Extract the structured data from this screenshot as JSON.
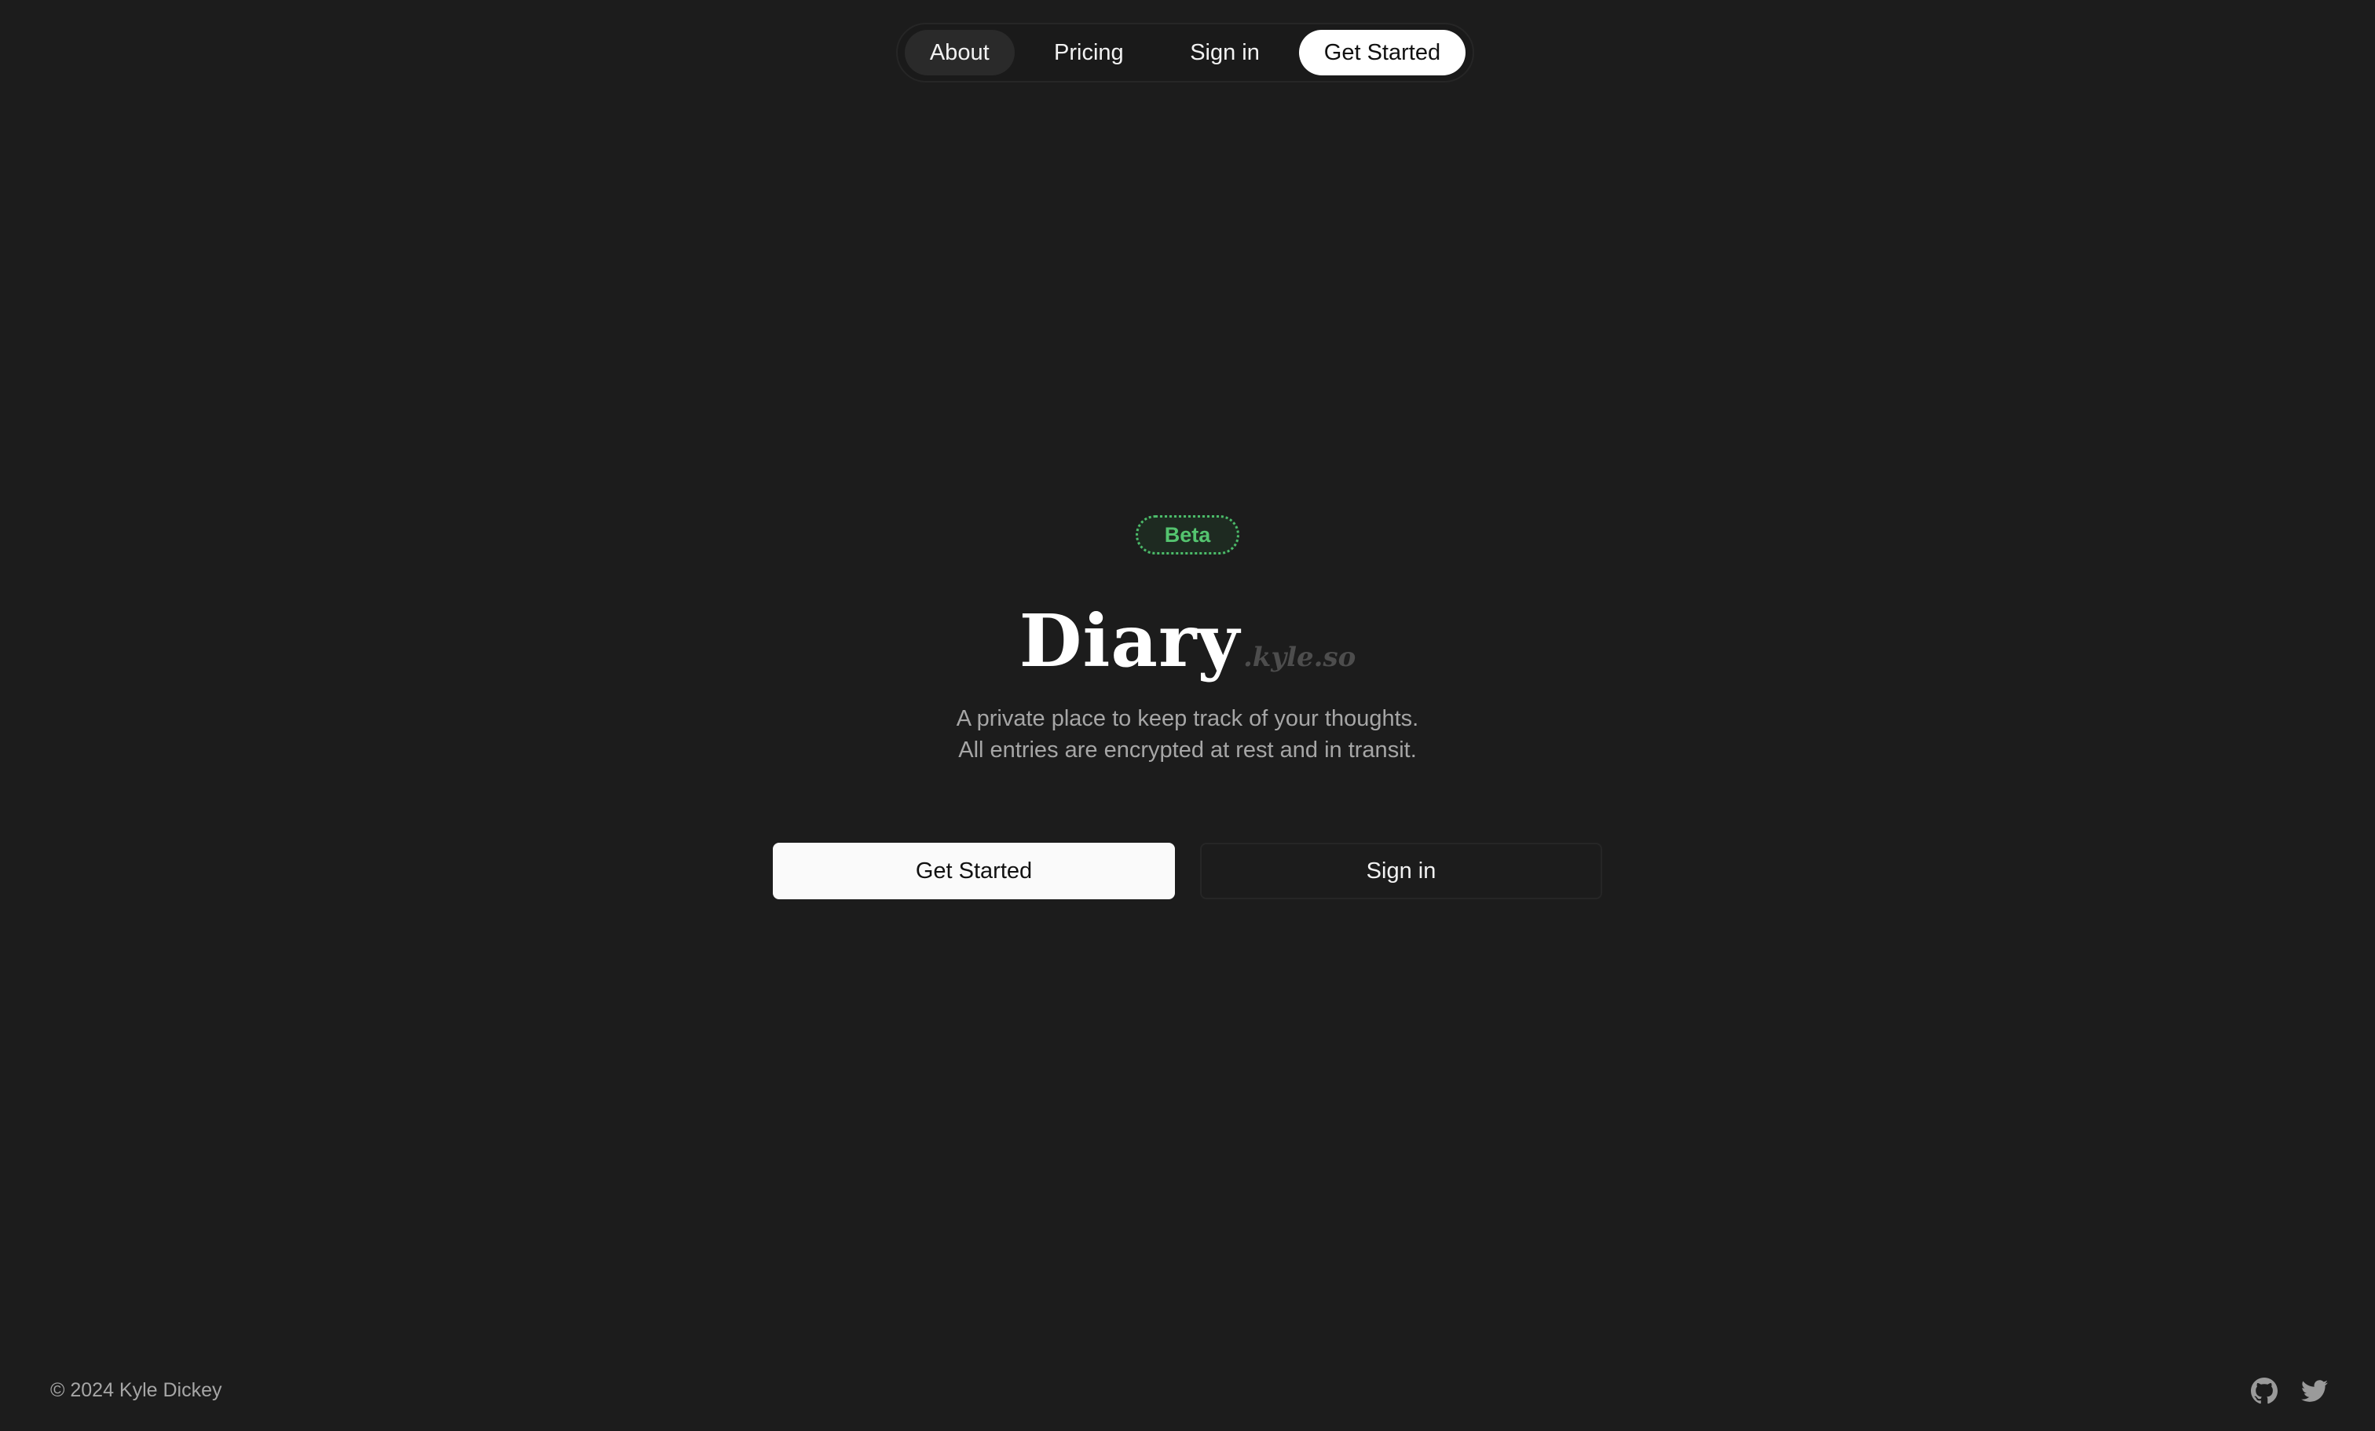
{
  "nav": {
    "about": "About",
    "pricing": "Pricing",
    "sign_in": "Sign in",
    "get_started": "Get Started"
  },
  "hero": {
    "badge": "Beta",
    "title": "Diary",
    "title_suffix": ".kyle.so",
    "tagline_line1": "A private place to keep track of your thoughts.",
    "tagline_line2": "All entries are encrypted at rest and in transit.",
    "primary_button": "Get Started",
    "secondary_button": "Sign in"
  },
  "footer": {
    "copyright": "© 2024 Kyle Dickey",
    "icons": [
      "github-icon",
      "twitter-icon"
    ]
  },
  "colors": {
    "background": "#1c1c1c",
    "badge_green": "#54c46f",
    "text_muted": "#a6a6a6",
    "primary_button_bg": "#fafafa"
  }
}
